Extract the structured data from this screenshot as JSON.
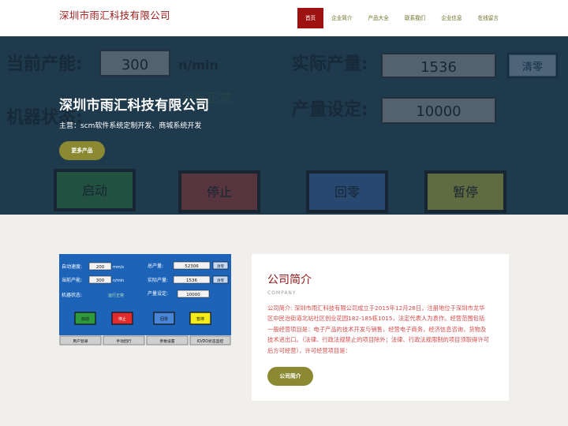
{
  "header": {
    "logo": "深圳市雨汇科技有限公司",
    "nav": [
      "首页",
      "企业简介",
      "产品大全",
      "联系我们",
      "企业信息",
      "在线留言"
    ]
  },
  "hero": {
    "title": "深圳市雨汇科技有限公司",
    "subtitle": "主营：scm软件系统定制开发、商城系统开发",
    "button": "更多产品",
    "panel": {
      "current_label": "当前产能:",
      "current_value": "300",
      "current_unit": "n/min",
      "actual_label": "实际产量:",
      "actual_value": "1536",
      "clear_label": "清零",
      "state_label": "机器状态:",
      "state_value": "运行正常",
      "set_label": "产量设定:",
      "set_value": "10000",
      "buttons": [
        "启动",
        "停止",
        "回零",
        "暂停"
      ]
    }
  },
  "panel_image": {
    "speed_label": "自动速度:",
    "speed_value": "200",
    "speed_unit": "mm/s",
    "total_label": "总产量:",
    "total_value": "52306",
    "capacity_label": "当前产能:",
    "capacity_value": "300",
    "capacity_unit": "n/min",
    "actual_label": "实际产量:",
    "actual_value": "1536",
    "state_label": "机器状态:",
    "state_value": "运行正常",
    "set_label": "产量设定:",
    "set_value": "10000",
    "clear_label": "清零",
    "buttons": [
      "启动",
      "停止",
      "回零",
      "暂停"
    ],
    "tabs": [
      "用户登录",
      "手动回行",
      "参数设置",
      "IO/DO状态监控"
    ]
  },
  "about": {
    "title": "公司简介",
    "subtitle": "COMPANY",
    "text": "公司简介: 深圳市雨汇科技有限公司成立于2015年12月28日，注册地位于深圳市龙华区中民治街道北站社区创业花园182-185栋1015，法定代表人为袁作。经营范围包括一般经营项目是：电子产品的技术开发与销售，经营电子商务，经济信息咨询，货物及技术进出口。（法律、行政法规禁止的项目除外；法律、行政法规限制的项目须取得许可后方可经营），许可经营项目是：",
    "button": "公司简介"
  },
  "colors": {
    "brand_red": "#9e1111",
    "olive": "#8b8a32",
    "background": "#f1efeb"
  }
}
